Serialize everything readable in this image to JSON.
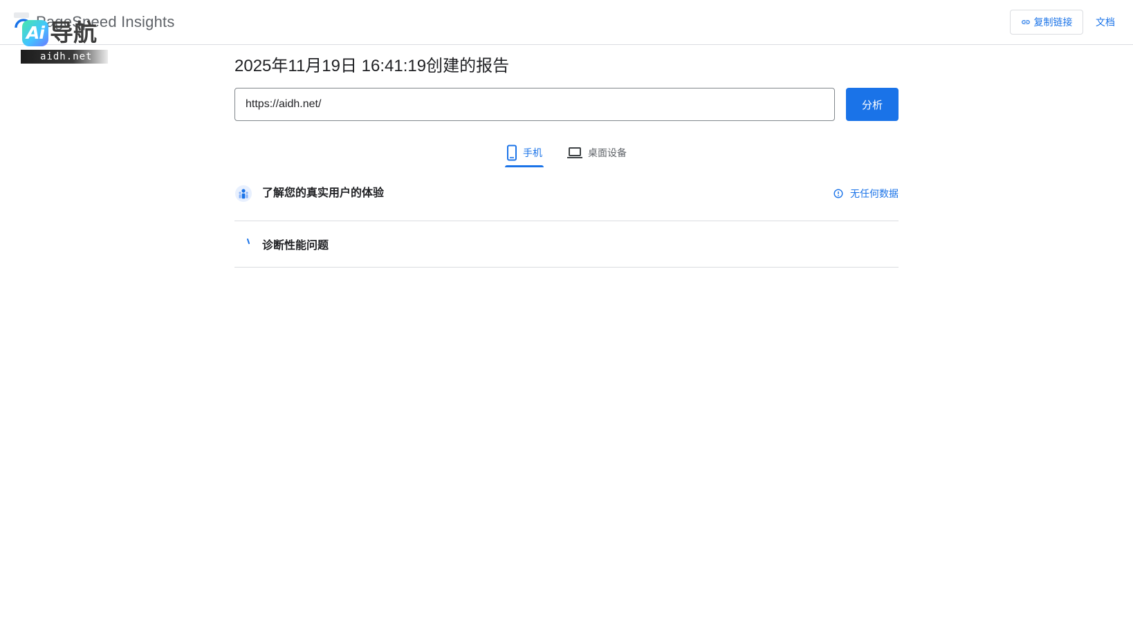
{
  "header": {
    "product_name": "PageSpeed Insights",
    "copy_link_label": "复制链接",
    "docs_label": "文档"
  },
  "watermark": {
    "mark": "Ai",
    "name": "导航",
    "url": "aidh.net"
  },
  "report": {
    "title": "2025年11月19日 16:41:19创建的报告",
    "url_value": "https://aidh.net/",
    "analyze_label": "分析"
  },
  "tabs": [
    {
      "label": "手机",
      "icon": "mobile-icon",
      "active": true
    },
    {
      "label": "桌面设备",
      "icon": "laptop-icon",
      "active": false
    }
  ],
  "sections": {
    "real_users": {
      "label": "了解您的真实用户的体验",
      "icon": "users-icon",
      "status_label": "无任何数据",
      "status_icon": "info-icon"
    },
    "diagnose": {
      "label": "诊断性能问题",
      "icon": "loading-spinner-icon"
    }
  },
  "colors": {
    "accent": "#1a73e8",
    "text": "#202124",
    "muted": "#5f6368",
    "divider": "#dadce0"
  }
}
